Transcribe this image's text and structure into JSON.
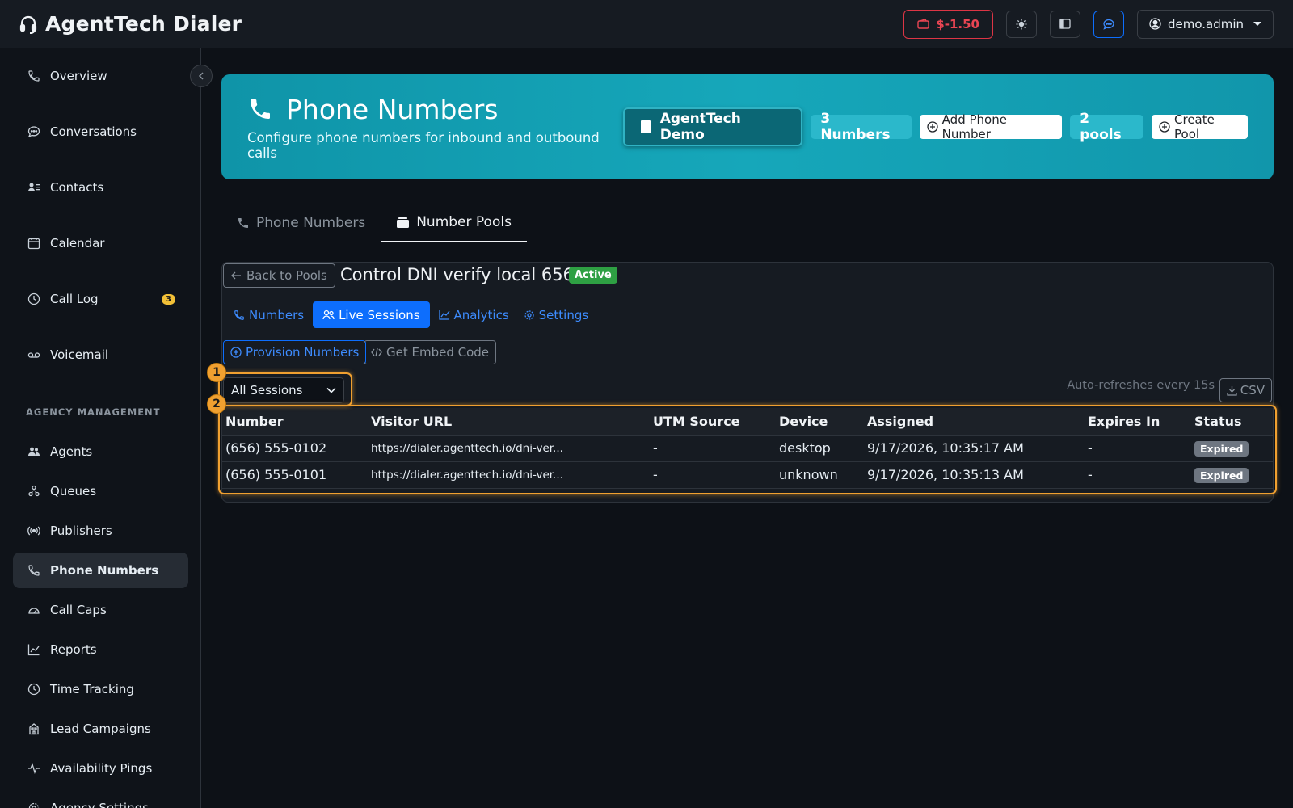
{
  "app": {
    "title": "AgentTech Dialer",
    "balance": "$-1.50",
    "user": "demo.admin"
  },
  "sidebar": {
    "items": [
      {
        "label": "Overview",
        "icon": "phone-icon"
      },
      {
        "label": "Conversations",
        "icon": "chat-icon"
      },
      {
        "label": "Contacts",
        "icon": "contacts-icon"
      },
      {
        "label": "Calendar",
        "icon": "calendar-icon"
      },
      {
        "label": "Call Log",
        "icon": "clock-icon",
        "badge": "3"
      },
      {
        "label": "Voicemail",
        "icon": "voicemail-icon"
      }
    ],
    "section_label": "AGENCY MANAGEMENT",
    "agency_items": [
      {
        "label": "Agents",
        "icon": "people-icon"
      },
      {
        "label": "Queues",
        "icon": "queue-icon"
      },
      {
        "label": "Publishers",
        "icon": "broadcast-icon"
      },
      {
        "label": "Phone Numbers",
        "icon": "phone-icon",
        "active": true
      },
      {
        "label": "Call Caps",
        "icon": "speedometer-icon"
      },
      {
        "label": "Reports",
        "icon": "chart-icon"
      },
      {
        "label": "Time Tracking",
        "icon": "clock-icon"
      },
      {
        "label": "Lead Campaigns",
        "icon": "building-icon"
      },
      {
        "label": "Availability Pings",
        "icon": "pulse-icon"
      },
      {
        "label": "Agency Settings",
        "icon": "gear-icon"
      }
    ]
  },
  "hero": {
    "title": "Phone Numbers",
    "subtitle": "Configure phone numbers for inbound and outbound calls",
    "org_label": "AgentTech Demo",
    "numbers_count": "3 Numbers",
    "add_number_label": "Add Phone Number",
    "pools_count": "2 pools",
    "create_pool_label": "Create Pool"
  },
  "tabs": [
    {
      "label": "Phone Numbers"
    },
    {
      "label": "Number Pools",
      "active": true
    }
  ],
  "pool": {
    "back_label": "Back to Pools",
    "name": "Control DNI verify local 656",
    "status": "Active",
    "subtabs": [
      {
        "label": "Numbers"
      },
      {
        "label": "Live Sessions",
        "active": true
      },
      {
        "label": "Analytics"
      },
      {
        "label": "Settings"
      }
    ],
    "provision_label": "Provision Numbers",
    "embed_label": "Get Embed Code",
    "session_filter": "All Sessions",
    "refresh_note": "Auto-refreshes every 15s",
    "csv_label": "CSV",
    "markers": [
      "1",
      "2"
    ],
    "table": {
      "columns": [
        "Number",
        "Visitor URL",
        "UTM Source",
        "Device",
        "Assigned",
        "Expires In",
        "Status"
      ],
      "rows": [
        {
          "number": "(656) 555-0102",
          "url": "https://dialer.agenttech.io/dni-ver...",
          "utm": "-",
          "device": "desktop",
          "assigned": "9/17/2026, 10:35:17 AM",
          "expires": "-",
          "status": "Expired"
        },
        {
          "number": "(656) 555-0101",
          "url": "https://dialer.agenttech.io/dni-ver...",
          "utm": "-",
          "device": "unknown",
          "assigned": "9/17/2026, 10:35:13 AM",
          "expires": "-",
          "status": "Expired"
        }
      ]
    }
  },
  "colors": {
    "accent": "#0d6efd",
    "hero": "#16a7ba",
    "danger": "#dc3545",
    "success": "#2ea043",
    "highlight": "#f0a030"
  }
}
